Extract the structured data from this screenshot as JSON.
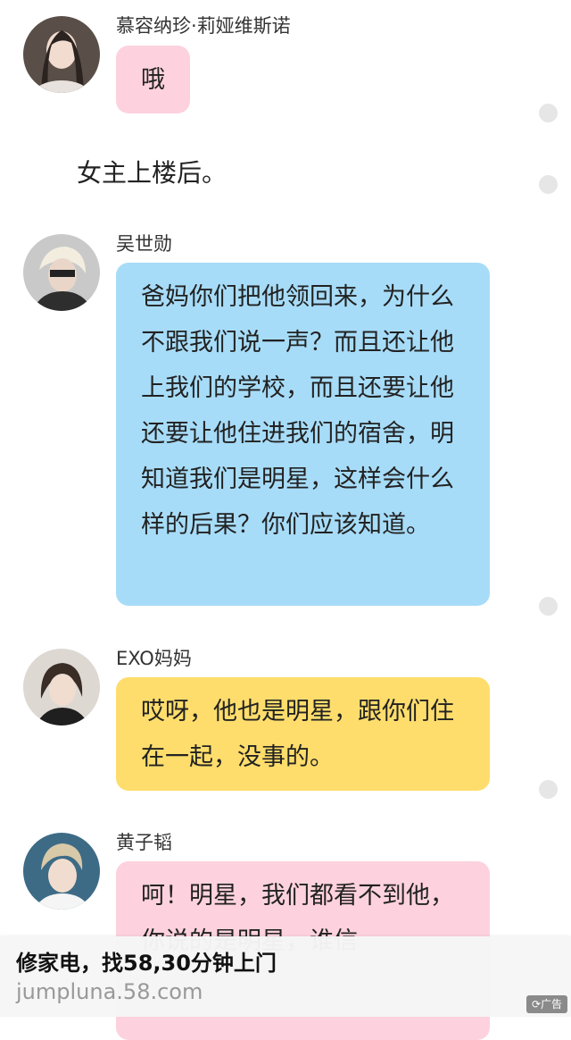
{
  "messages": [
    {
      "sender": "慕容纳珍·莉娅维斯诺",
      "text": "哦",
      "color": "#fdd2de",
      "avatar": "avatar-girl-long-hair"
    },
    {
      "narration": "女主上楼后。"
    },
    {
      "sender": "吴世勋",
      "text": "爸妈你们把他领回来，为什么不跟我们说一声？而且还让他上我们的学校，而且还要让他还要让他住进我们的宿舍，明知道我们是明星，这样会什么样的后果？你们应该知道。",
      "color": "#a7dcf8",
      "avatar": "avatar-boy-blond-hair"
    },
    {
      "sender": "EXO妈妈",
      "text": "哎呀，他也是明星，跟你们住在一起，没事的。",
      "color": "#fedd6c",
      "avatar": "avatar-woman-short-hair"
    },
    {
      "sender": "黄子韬",
      "text": "呵！明星，我们都看不到他，你说的是明星，谁信",
      "color": "#fdd2de",
      "avatar": "avatar-boy-light-hair"
    }
  ],
  "ad": {
    "title": "修家电，找58,30分钟上门",
    "url": "jumpluna.58.com",
    "badge": "⟳广告"
  }
}
